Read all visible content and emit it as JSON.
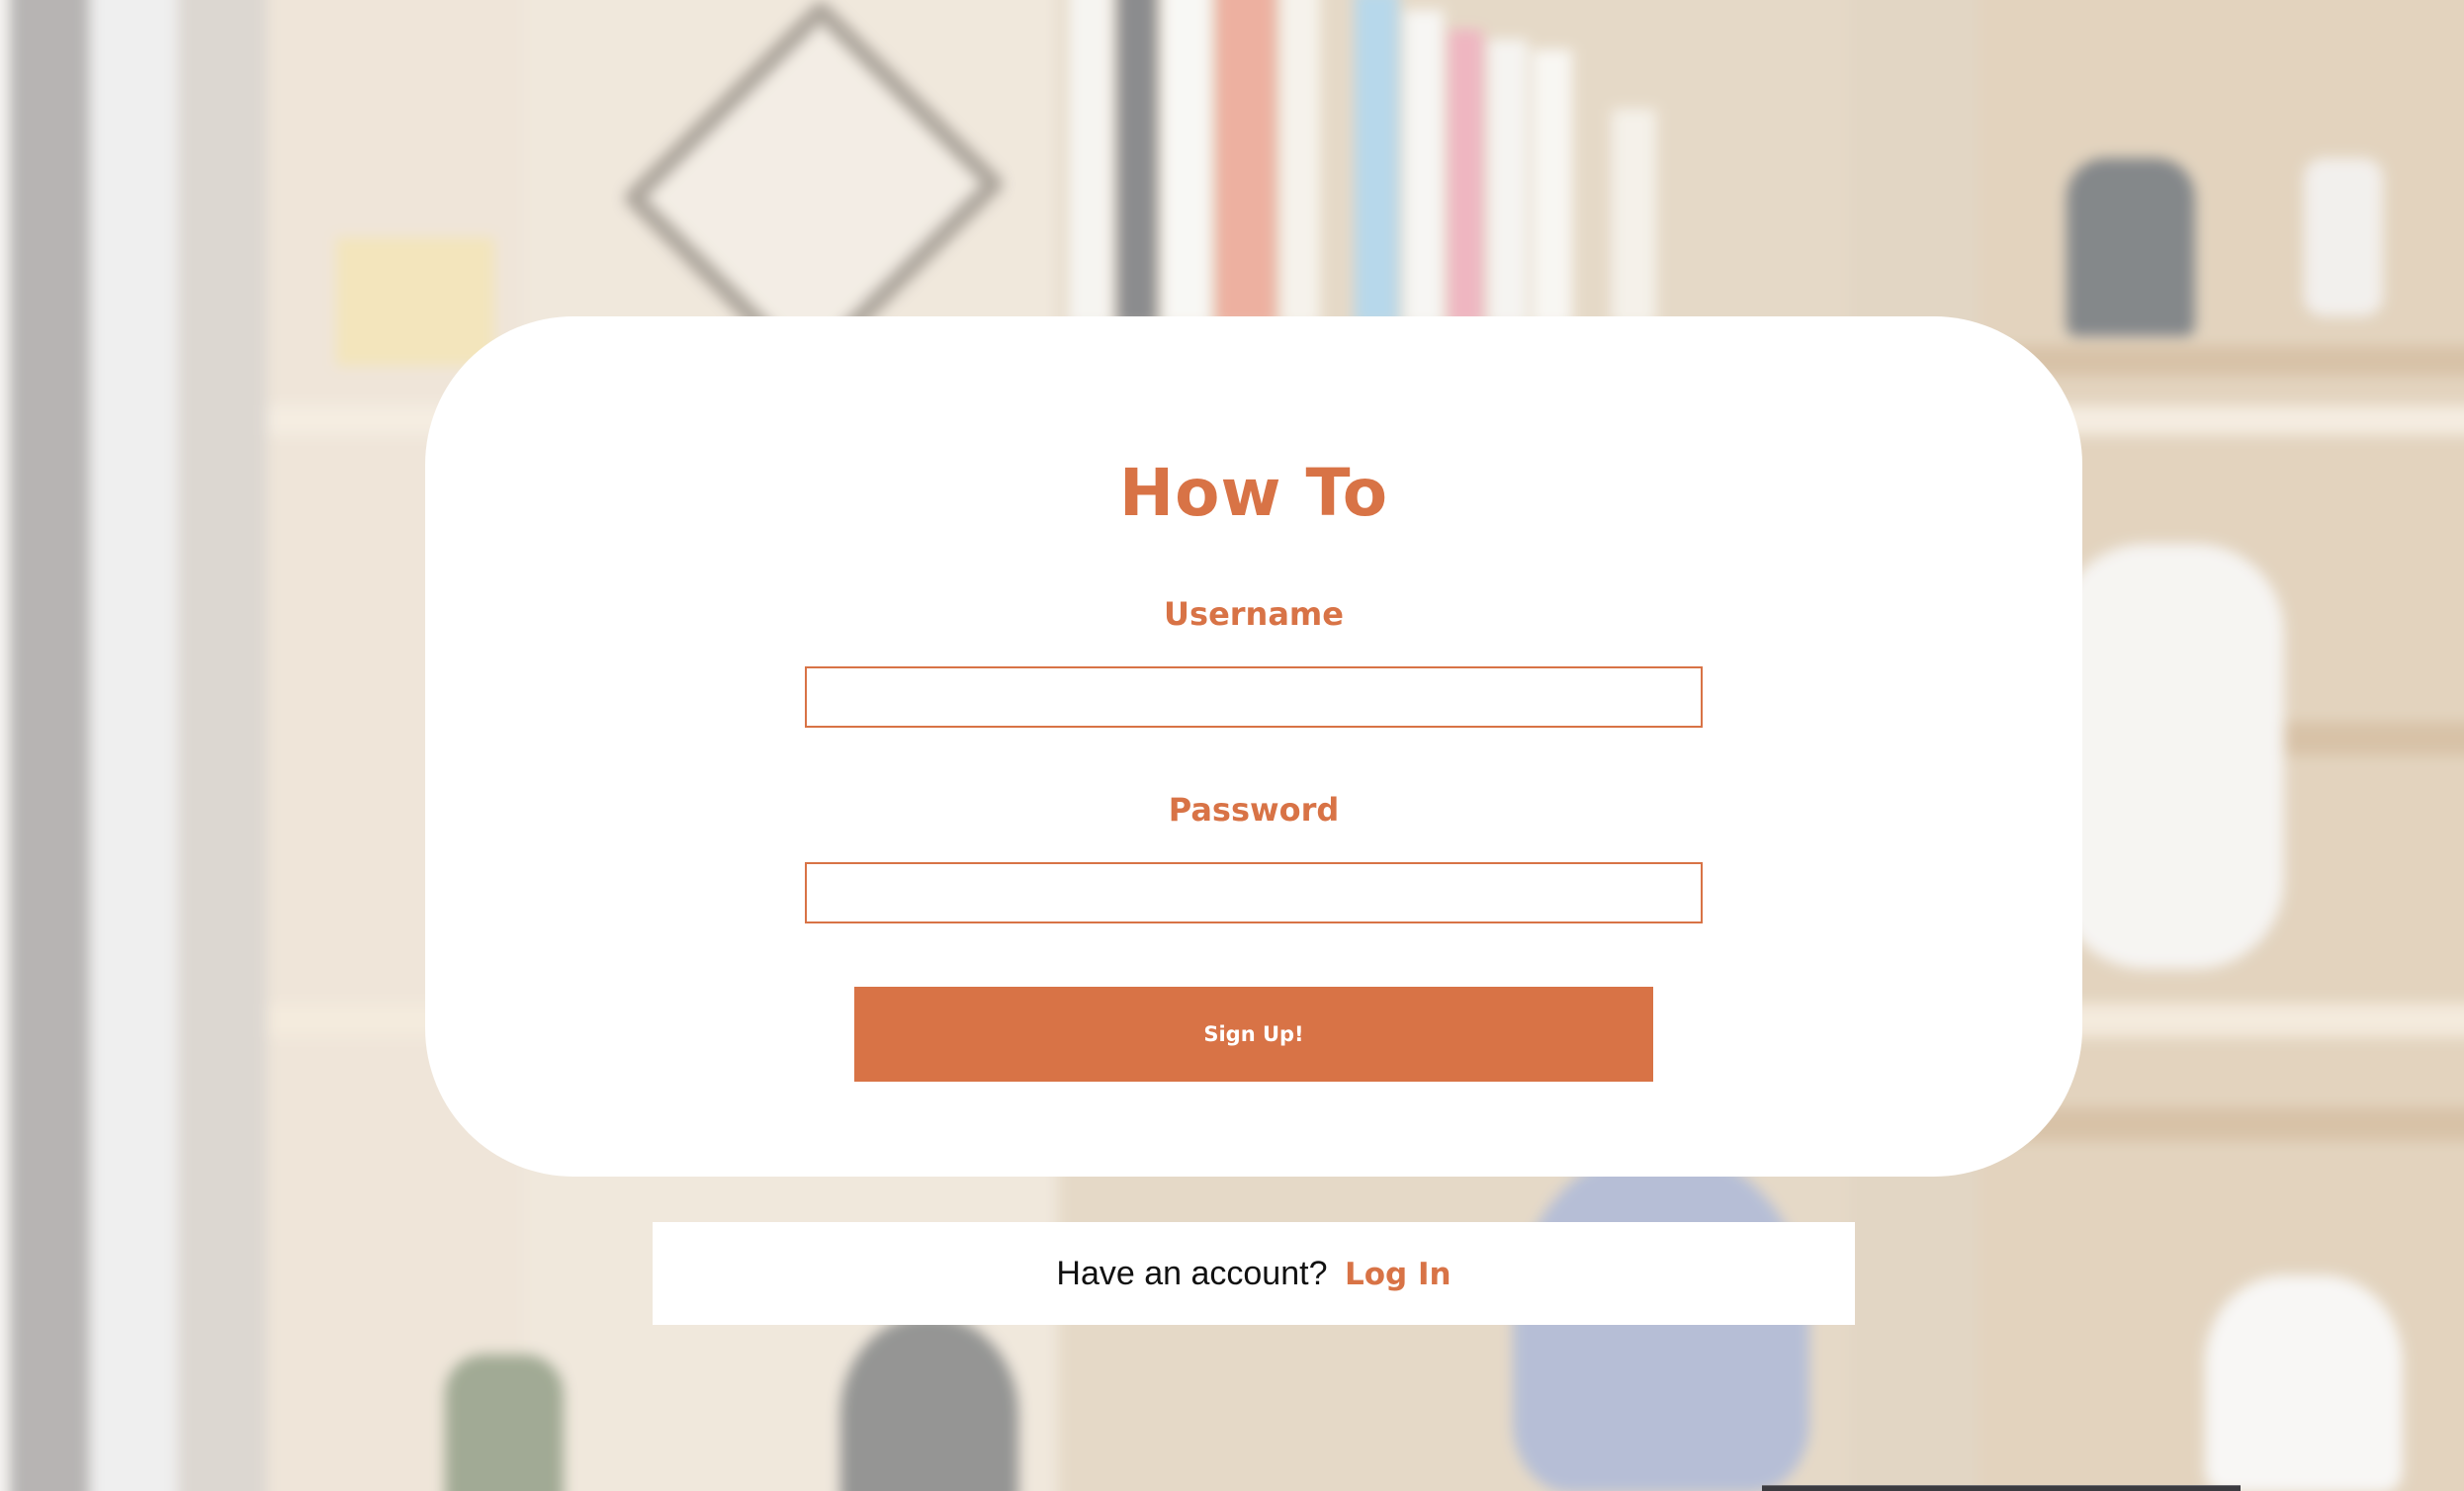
{
  "form": {
    "title": "How To",
    "username_label": "Username",
    "username_value": "",
    "password_label": "Password",
    "password_value": "",
    "submit_label": "Sign Up!"
  },
  "footer": {
    "prompt": "Have an account?",
    "link_label": "Log In"
  },
  "colors": {
    "accent": "#d87346",
    "card": "#ffffff",
    "text": "#111111"
  }
}
